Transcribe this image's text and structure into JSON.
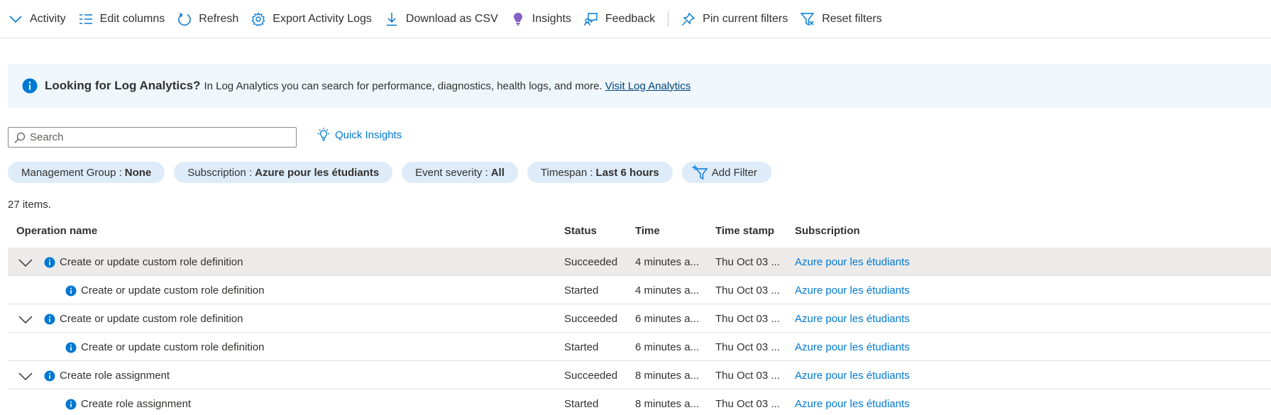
{
  "toolbar": {
    "items": [
      {
        "label": "Activity",
        "icon": "chevron-down-icon"
      },
      {
        "label": "Edit columns",
        "icon": "edit-columns-icon"
      },
      {
        "label": "Refresh",
        "icon": "refresh-icon"
      },
      {
        "label": "Export Activity Logs",
        "icon": "gear-icon"
      },
      {
        "label": "Download as CSV",
        "icon": "download-icon"
      },
      {
        "label": "Insights",
        "icon": "lightbulb-icon"
      },
      {
        "label": "Feedback",
        "icon": "feedback-icon"
      },
      {
        "label": "Pin current filters",
        "icon": "pin-icon"
      },
      {
        "label": "Reset filters",
        "icon": "reset-filter-icon"
      }
    ]
  },
  "banner": {
    "title": "Looking for Log Analytics?",
    "text": "In Log Analytics you can search for performance, diagnostics, health logs, and more.",
    "link": "Visit Log Analytics"
  },
  "search": {
    "placeholder": "Search"
  },
  "quick_insights": "Quick Insights",
  "filters": [
    {
      "key": "Management Group :",
      "value": "None"
    },
    {
      "key": "Subscription :",
      "value": "Azure pour les étudiants"
    },
    {
      "key": "Event severity :",
      "value": "All"
    },
    {
      "key": "Timespan :",
      "value": "Last 6 hours"
    }
  ],
  "add_filter": "Add Filter",
  "count": "27 items.",
  "columns": [
    "Operation name",
    "Status",
    "Time",
    "Time stamp",
    "Subscription"
  ],
  "rows": [
    {
      "name": "Create or update custom role definition",
      "status": "Succeeded",
      "time": "4 minutes a...",
      "stamp": "Thu Oct 03 ...",
      "sub": "Azure pour les étudiants"
    },
    {
      "name": "Create or update custom role definition",
      "status": "Started",
      "time": "4 minutes a...",
      "stamp": "Thu Oct 03 ...",
      "sub": "Azure pour les étudiants"
    },
    {
      "name": "Create or update custom role definition",
      "status": "Succeeded",
      "time": "6 minutes a...",
      "stamp": "Thu Oct 03 ...",
      "sub": "Azure pour les étudiants"
    },
    {
      "name": "Create or update custom role definition",
      "status": "Started",
      "time": "6 minutes a...",
      "stamp": "Thu Oct 03 ...",
      "sub": "Azure pour les étudiants"
    },
    {
      "name": "Create role assignment",
      "status": "Succeeded",
      "time": "8 minutes a...",
      "stamp": "Thu Oct 03 ...",
      "sub": "Azure pour les étudiants"
    },
    {
      "name": "Create role assignment",
      "status": "Started",
      "time": "8 minutes a...",
      "stamp": "Thu Oct 03 ...",
      "sub": "Azure pour les étudiants"
    }
  ],
  "colors": {
    "accent": "#0078d4",
    "banner_bg": "#eff6fc",
    "pill_bg": "#deecf9",
    "selected_row": "#edebe9"
  }
}
